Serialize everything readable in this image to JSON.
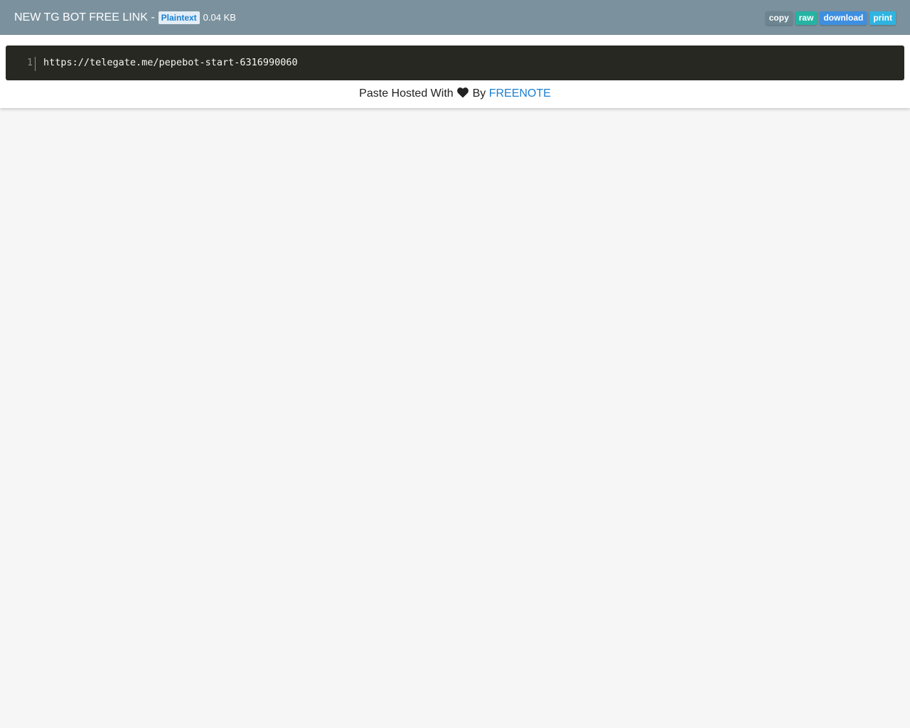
{
  "header": {
    "title": "NEW TG BOT FREE LINK -",
    "language": "Plaintext",
    "size": "0.04 KB",
    "actions": {
      "copy": "copy",
      "raw": "raw",
      "download": "download",
      "print": "print"
    }
  },
  "code": {
    "lines": [
      {
        "number": "1",
        "text": "https://telegate.me/pepebot-start-6316990060"
      }
    ]
  },
  "footer": {
    "prefix": "Paste Hosted With",
    "by": "By",
    "link_text": "FREENOTE",
    "heart_icon": "heart-icon"
  },
  "colors": {
    "header_bg": "#7b929e",
    "code_bg": "#272822",
    "link": "#1a7fd1",
    "copy_btn": "#6c8591",
    "raw_btn": "#26b3a3",
    "download_btn": "#3e8fe0",
    "print_btn": "#2fb4e1"
  }
}
